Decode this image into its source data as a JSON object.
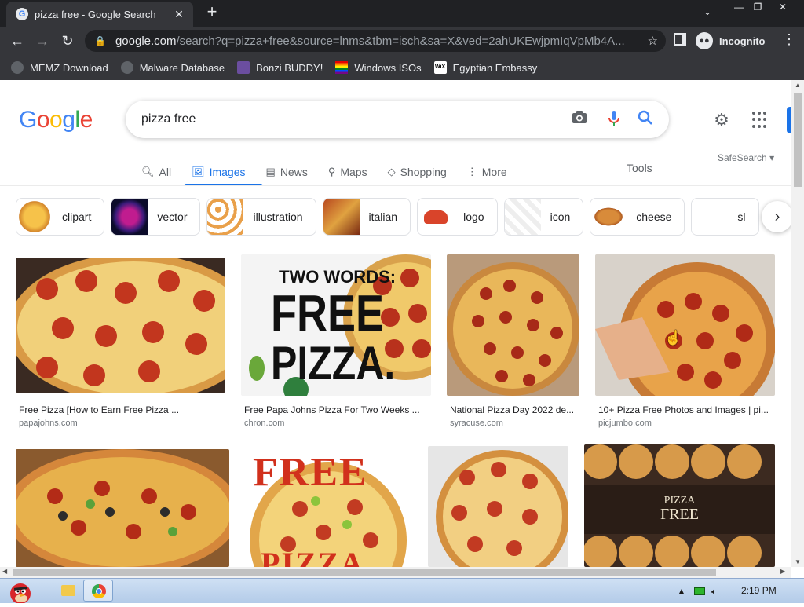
{
  "browser": {
    "tab_title": "pizza free - Google Search",
    "url_host": "google.com",
    "url_path": "/search?q=pizza+free&source=lnms&tbm=isch&sa=X&ved=2ahUKEwjpmIqVpMb4A...",
    "incognito_label": "Incognito",
    "bookmarks": [
      "MEMZ Download",
      "Malware Database",
      "Bonzi BUDDY!",
      "Windows ISOs",
      "Egyptian Embassy"
    ]
  },
  "google": {
    "query": "pizza free",
    "tabs": [
      "All",
      "Images",
      "News",
      "Maps",
      "Shopping",
      "More"
    ],
    "active_tab": "Images",
    "tools_label": "Tools",
    "safesearch_label": "SafeSearch",
    "chips": [
      "clipart",
      "vector",
      "illustration",
      "italian",
      "logo",
      "icon",
      "cheese",
      "sl"
    ]
  },
  "results": [
    {
      "caption": "Free Pizza [How to Earn Free Pizza ...",
      "source": "papajohns.com"
    },
    {
      "caption": "Free Papa Johns Pizza For Two Weeks ...",
      "source": "chron.com",
      "image_text_1": "TWO WORDS:",
      "image_text_2": "FREE",
      "image_text_3": "PIZZA."
    },
    {
      "caption": "National Pizza Day 2022 de...",
      "source": "syracuse.com"
    },
    {
      "caption": "10+ Pizza Free Photos and Images | pi...",
      "source": "picjumbo.com"
    },
    {
      "caption": "",
      "source": ""
    },
    {
      "caption": "",
      "source": "",
      "image_text_1": "FREE",
      "image_text_2": "PIZZA"
    },
    {
      "caption": "",
      "source": ""
    },
    {
      "caption": "",
      "source": "",
      "image_text_1": "PIZZA",
      "image_text_2": "FREE"
    }
  ],
  "taskbar": {
    "clock": "2:19 PM"
  },
  "colors": {
    "google_blue": "#4285f4",
    "google_red": "#ea4335",
    "google_yellow": "#fbbc05",
    "google_green": "#34a853",
    "active_tab_blue": "#1a73e8"
  }
}
